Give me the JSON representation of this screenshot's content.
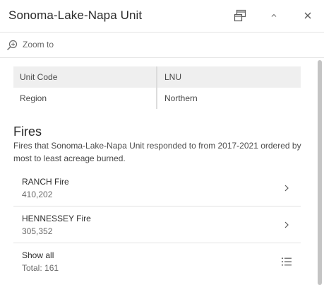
{
  "header": {
    "title": "Sonoma-Lake-Napa Unit"
  },
  "zoom": {
    "label": "Zoom to"
  },
  "attributes": [
    {
      "key": "Unit Code",
      "value": "LNU"
    },
    {
      "key": "Region",
      "value": "Northern"
    }
  ],
  "fires": {
    "heading": "Fires",
    "description": "Fires that Sonoma-Lake-Napa Unit responded to from 2017-2021 ordered by most to least acreage burned.",
    "items": [
      {
        "name": "RANCH Fire",
        "acres": "410,202"
      },
      {
        "name": "HENNESSEY Fire",
        "acres": "305,352"
      }
    ],
    "show_all": {
      "label": "Show all",
      "total": "Total: 161"
    }
  },
  "colors": {
    "text": "#323232",
    "muted": "#6a6a6a",
    "row_shade": "#efefef",
    "divider": "#e2e2e2"
  }
}
